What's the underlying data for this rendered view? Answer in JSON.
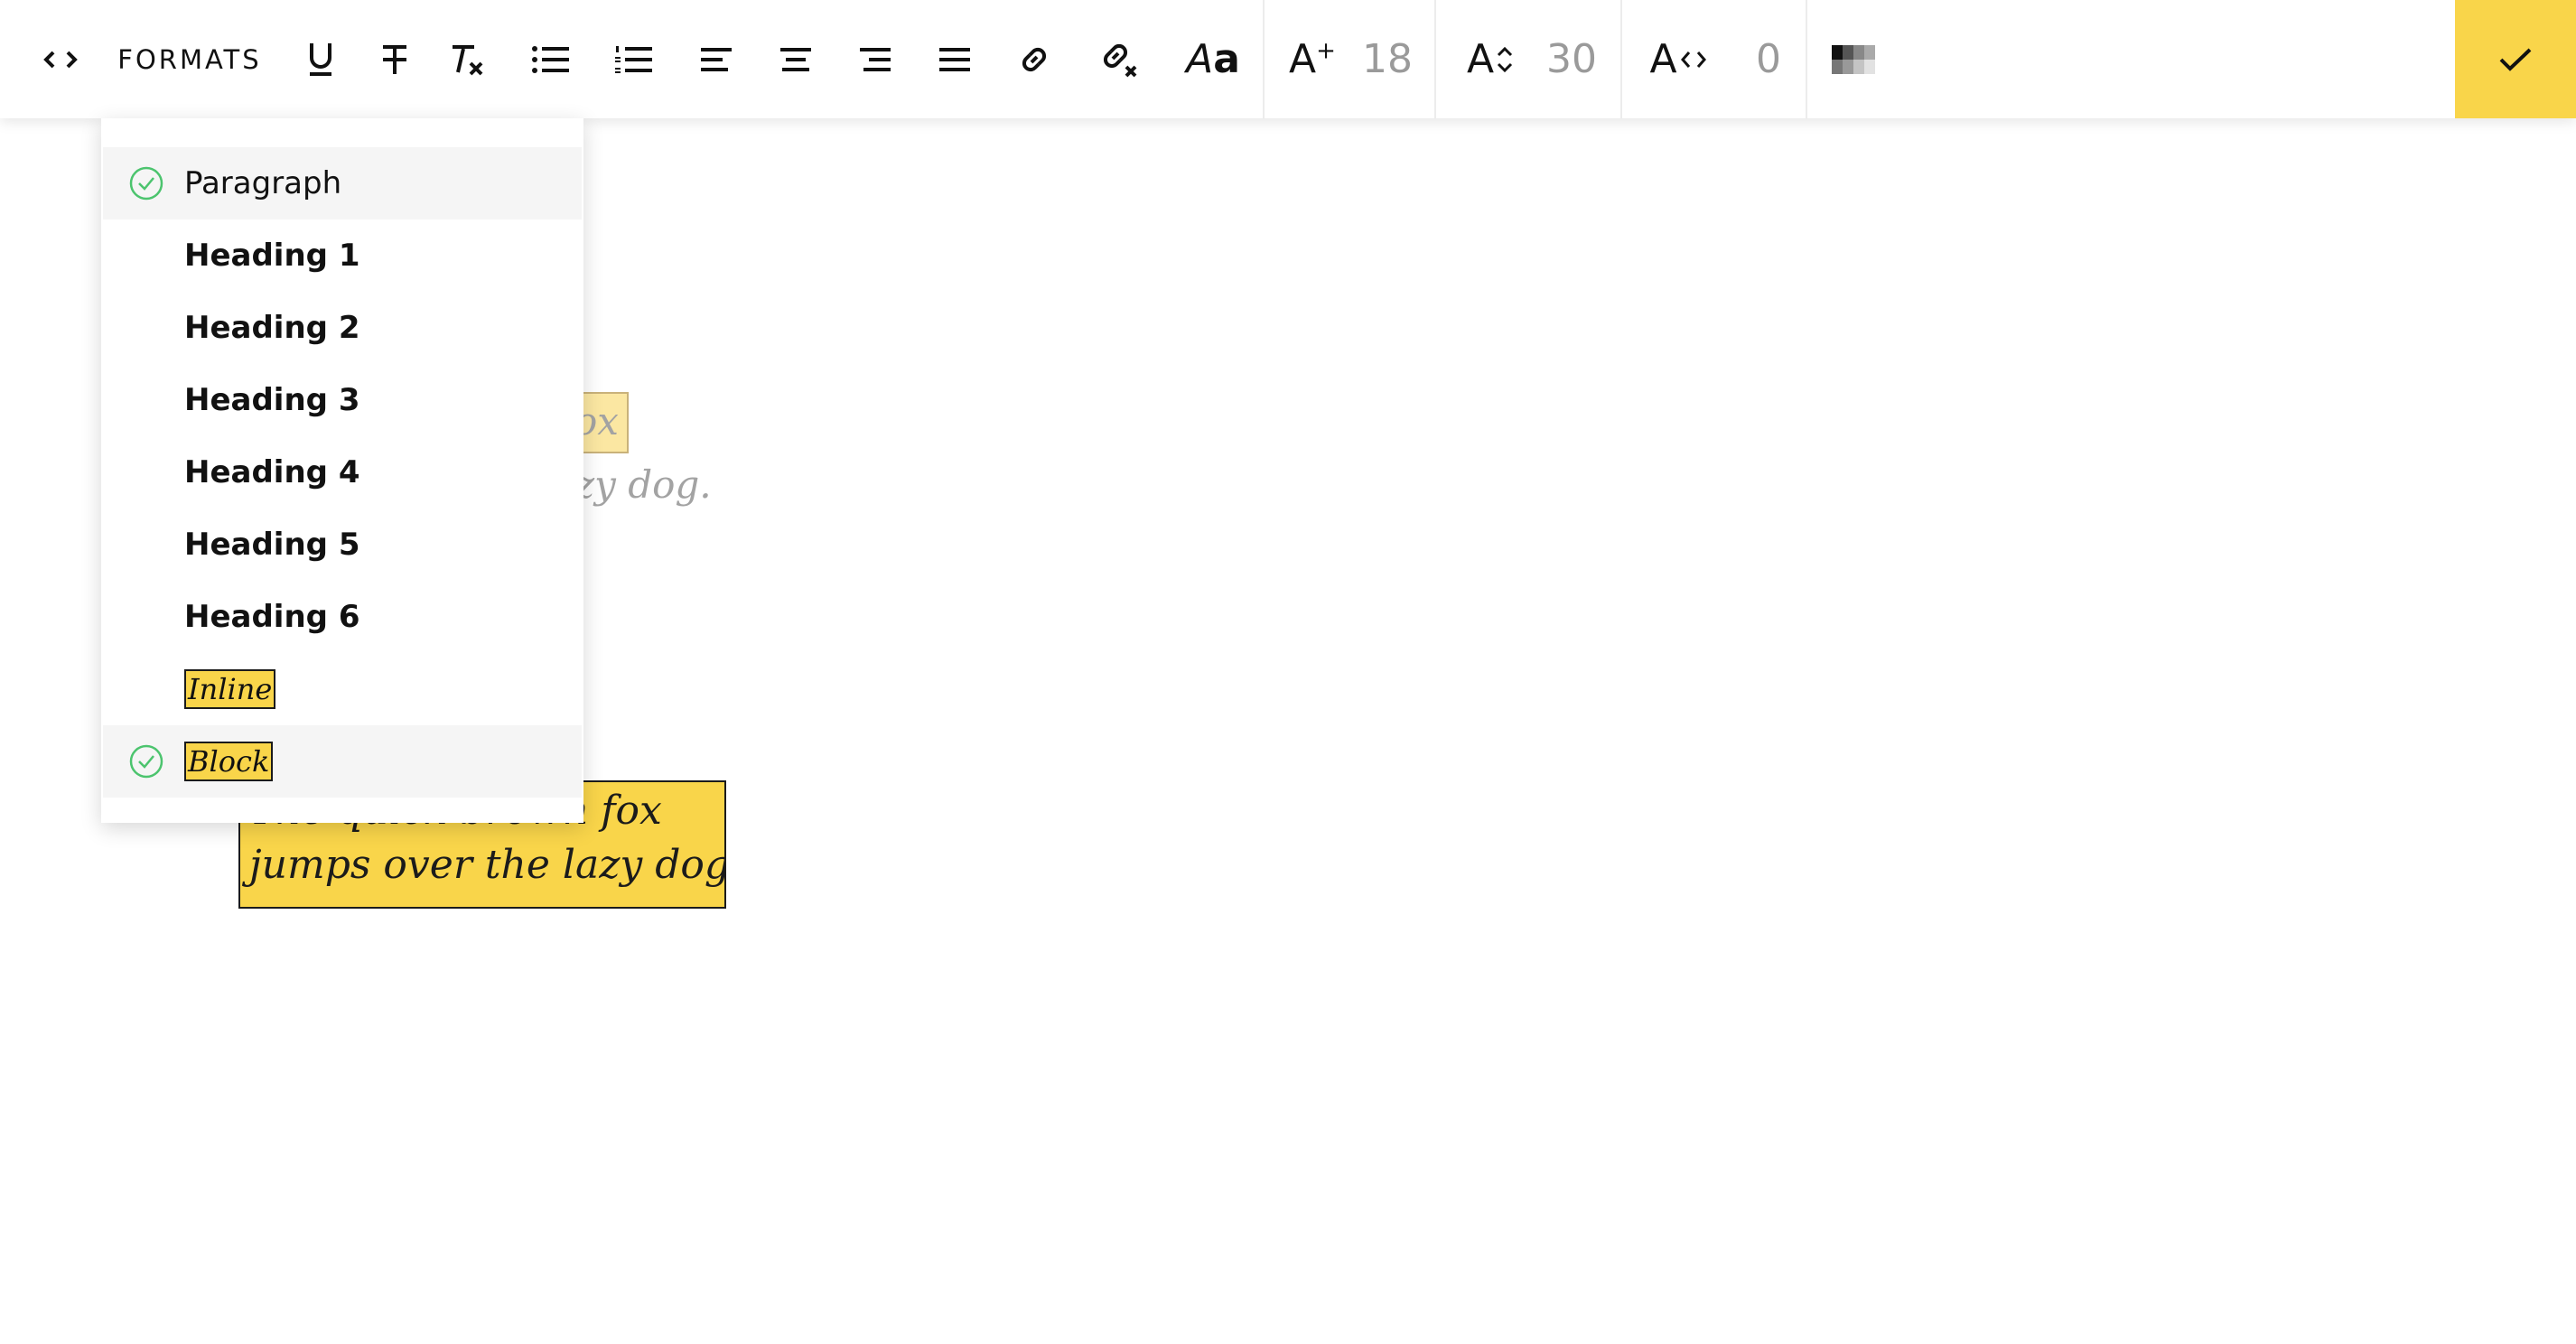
{
  "toolbar": {
    "formats_label": "FORMATS",
    "font_style_label_italic": "A",
    "font_style_label_bold": "a",
    "font_size_letter": "A",
    "font_size_sup": "+",
    "font_size_value": "18",
    "line_height_letter": "A",
    "line_height_value": "30",
    "letter_spacing_letter": "A",
    "letter_spacing_value": "0",
    "icons": [
      "code-view-icon",
      "underline-icon",
      "strikethrough-icon",
      "clear-format-icon",
      "bulleted-list-icon",
      "numbered-list-icon",
      "align-left-icon",
      "align-center-icon",
      "align-right-icon",
      "justify-icon",
      "link-icon",
      "unlink-icon",
      "font-style-icon",
      "font-size-icon",
      "line-height-icon",
      "letter-spacing-icon",
      "color-swatch-icon",
      "check-icon"
    ]
  },
  "content": {
    "faded_line_1_fragment": "ox",
    "faded_line_2_fragment": "zy dog.",
    "block_line_1": "The quick brown fox",
    "block_line_2": "jumps over the lazy dog."
  },
  "formats_menu": {
    "items": [
      {
        "label": "Paragraph",
        "selected": true
      },
      {
        "label": "Heading 1",
        "selected": false
      },
      {
        "label": "Heading 2",
        "selected": false
      },
      {
        "label": "Heading 3",
        "selected": false
      },
      {
        "label": "Heading 4",
        "selected": false
      },
      {
        "label": "Heading 5",
        "selected": false
      },
      {
        "label": "Heading 6",
        "selected": false
      },
      {
        "label": "Inline",
        "selected": false
      },
      {
        "label": "Block",
        "selected": true
      }
    ]
  },
  "colors": {
    "accent": "#f9d54a",
    "check_green": "#4cc46e",
    "muted_text": "#9a9a9a"
  }
}
